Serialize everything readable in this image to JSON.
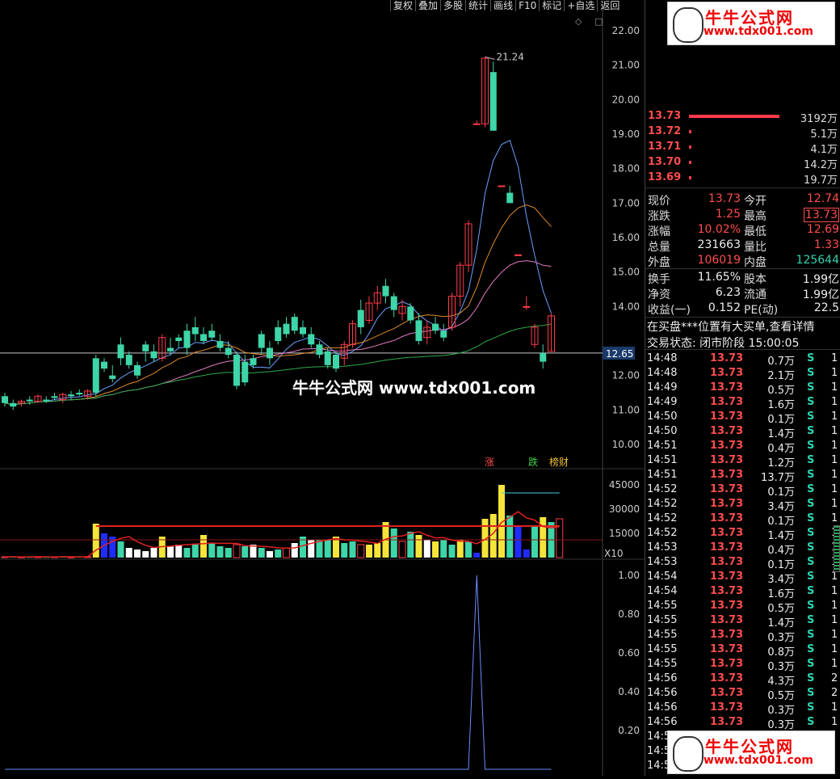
{
  "toolbar": [
    "复权",
    "叠加",
    "多股",
    "统计",
    "画线",
    "F10",
    "标记",
    "+自选",
    "返回"
  ],
  "main_chart": {
    "price_ticks": [
      "22.00",
      "21.00",
      "20.00",
      "19.00",
      "18.00",
      "17.00",
      "16.00",
      "15.00",
      "14.00",
      "12.00",
      "11.00",
      "10.00"
    ],
    "current_price_label": "12.65",
    "high_label": "21.24",
    "watermark": "牛牛公式网 www.tdx001.com",
    "tags": [
      "涨",
      "跌",
      "榜财"
    ],
    "ma_colors": {
      "ma5": "#6aa0ff",
      "ma10": "#e08a2a",
      "ma20": "#e07ac0",
      "ma60": "#2ea84a"
    }
  },
  "volume_chart": {
    "ticks": [
      "45000",
      "30000",
      "15000"
    ],
    "unit": "X10"
  },
  "indicator_chart": {
    "ticks": [
      "1.00",
      "0.80",
      "0.60",
      "0.40",
      "0.20"
    ]
  },
  "chart_data": [
    {
      "type": "candlestick",
      "ylim": [
        9.5,
        22.5
      ],
      "candles": [
        [
          11.4,
          11.5,
          11.1,
          11.2
        ],
        [
          11.2,
          11.3,
          11.0,
          11.1
        ],
        [
          11.2,
          11.3,
          11.1,
          11.25
        ],
        [
          11.3,
          11.4,
          11.15,
          11.25
        ],
        [
          11.25,
          11.45,
          11.2,
          11.4
        ],
        [
          11.3,
          11.4,
          11.2,
          11.25
        ],
        [
          11.4,
          11.5,
          11.3,
          11.35
        ],
        [
          11.3,
          11.5,
          11.2,
          11.45
        ],
        [
          11.45,
          11.55,
          11.3,
          11.4
        ],
        [
          11.5,
          11.6,
          11.4,
          11.45
        ],
        [
          11.4,
          11.6,
          11.3,
          11.55
        ],
        [
          12.5,
          12.6,
          11.4,
          11.5
        ],
        [
          12.4,
          12.5,
          12.1,
          12.2
        ],
        [
          12.0,
          12.3,
          11.8,
          11.9
        ],
        [
          12.9,
          13.1,
          12.3,
          12.5
        ],
        [
          12.6,
          12.7,
          12.2,
          12.3
        ],
        [
          12.3,
          12.4,
          11.9,
          12.0
        ],
        [
          12.9,
          13.0,
          12.4,
          12.7
        ],
        [
          12.7,
          12.9,
          12.4,
          12.5
        ],
        [
          12.5,
          13.2,
          12.4,
          13.1
        ],
        [
          12.8,
          13.1,
          12.6,
          12.7
        ],
        [
          13.1,
          13.2,
          12.8,
          13.0
        ],
        [
          13.3,
          13.5,
          12.6,
          12.8
        ],
        [
          13.4,
          13.7,
          13.0,
          13.2
        ],
        [
          13.2,
          13.4,
          12.9,
          13.0
        ],
        [
          13.3,
          13.5,
          13.0,
          13.1
        ],
        [
          13.0,
          13.2,
          12.7,
          12.8
        ],
        [
          12.8,
          13.0,
          12.5,
          12.6
        ],
        [
          12.6,
          12.7,
          11.6,
          11.7
        ],
        [
          12.4,
          12.6,
          11.7,
          11.8
        ],
        [
          12.5,
          12.6,
          12.2,
          12.3
        ],
        [
          13.2,
          13.3,
          12.6,
          12.8
        ],
        [
          12.8,
          13.0,
          12.3,
          12.5
        ],
        [
          13.4,
          13.6,
          12.9,
          13.0
        ],
        [
          13.5,
          13.7,
          13.1,
          13.2
        ],
        [
          13.7,
          13.8,
          13.2,
          13.3
        ],
        [
          13.4,
          13.6,
          13.1,
          13.2
        ],
        [
          13.2,
          13.4,
          12.8,
          12.9
        ],
        [
          12.9,
          13.0,
          12.5,
          12.6
        ],
        [
          12.7,
          12.8,
          12.2,
          12.3
        ],
        [
          12.6,
          12.7,
          12.1,
          12.2
        ],
        [
          12.5,
          13.0,
          12.3,
          12.9
        ],
        [
          12.9,
          13.6,
          12.8,
          13.5
        ],
        [
          13.9,
          14.2,
          13.2,
          13.4
        ],
        [
          13.6,
          14.3,
          13.5,
          14.1
        ],
        [
          14.1,
          14.6,
          13.9,
          14.4
        ],
        [
          14.6,
          14.8,
          14.1,
          14.3
        ],
        [
          14.3,
          14.4,
          13.7,
          13.9
        ],
        [
          13.8,
          14.2,
          13.6,
          14.0
        ],
        [
          14.0,
          14.1,
          13.5,
          13.6
        ],
        [
          13.6,
          13.8,
          12.9,
          13.0
        ],
        [
          13.1,
          13.6,
          12.9,
          13.4
        ],
        [
          13.5,
          13.7,
          13.2,
          13.3
        ],
        [
          13.3,
          13.5,
          13.0,
          13.1
        ],
        [
          13.4,
          14.4,
          13.3,
          14.3
        ],
        [
          14.3,
          15.3,
          14.0,
          15.2
        ],
        [
          15.2,
          16.5,
          15.0,
          16.4
        ],
        [
          19.3,
          19.4,
          19.3,
          19.3
        ],
        [
          19.3,
          21.24,
          19.2,
          21.2
        ],
        [
          20.8,
          21.1,
          19.1,
          19.1
        ],
        [
          17.5,
          17.5,
          17.5,
          17.5
        ],
        [
          17.3,
          17.5,
          17.0,
          17.0
        ],
        [
          15.5,
          15.5,
          15.5,
          15.5
        ],
        [
          14.0,
          14.3,
          13.9,
          14.0
        ],
        [
          12.9,
          13.5,
          12.8,
          13.4
        ],
        [
          12.65,
          12.9,
          12.2,
          12.4
        ],
        [
          12.7,
          13.8,
          12.7,
          13.73
        ]
      ]
    },
    {
      "type": "bar",
      "ylim": [
        0,
        50000
      ],
      "values": [
        500,
        500,
        400,
        400,
        600,
        400,
        500,
        500,
        400,
        500,
        600,
        21000,
        15000,
        13000,
        10000,
        6000,
        5000,
        4000,
        6000,
        13000,
        7000,
        8000,
        6000,
        8000,
        14000,
        9000,
        7000,
        6000,
        8000,
        7000,
        8000,
        6000,
        4000,
        5000,
        6000,
        9000,
        13000,
        11000,
        11000,
        11000,
        13000,
        9000,
        10000,
        8000,
        8000,
        9000,
        22000,
        18000,
        10000,
        16000,
        14000,
        11000,
        10000,
        11000,
        8000,
        11000,
        10000,
        3000,
        24000,
        27000,
        45000,
        26000,
        20000,
        5000,
        20000,
        25000,
        22000,
        24000
      ],
      "colors": [
        "r",
        "g",
        "r",
        "g",
        "r",
        "g",
        "r",
        "g",
        "r",
        "g",
        "r",
        "y",
        "b",
        "b",
        "g",
        "w",
        "w",
        "w",
        "w",
        "y",
        "w",
        "w",
        "g",
        "g",
        "y",
        "g",
        "g",
        "g",
        "r",
        "g",
        "w",
        "g",
        "w",
        "g",
        "r",
        "w",
        "g",
        "w",
        "g",
        "g",
        "y",
        "g",
        "g",
        "r",
        "y",
        "y",
        "y",
        "g",
        "r",
        "g",
        "y",
        "w",
        "y",
        "g",
        "g",
        "y",
        "g",
        "b",
        "y",
        "y",
        "y",
        "g",
        "b",
        "b",
        "g",
        "y",
        "g",
        "r"
      ],
      "line1_level": 19500,
      "line2_level": 40000
    },
    {
      "type": "line",
      "ylim": [
        0,
        1.0
      ],
      "peak_index": 57,
      "peak_value": 1.0
    }
  ],
  "right_panel": {
    "order_book": [
      {
        "price": "13.73",
        "vol": "3192万",
        "bar": 100
      },
      {
        "price": "13.72",
        "vol": "5.1万",
        "bar": 2
      },
      {
        "price": "13.71",
        "vol": "4.1万",
        "bar": 2
      },
      {
        "price": "13.70",
        "vol": "14.2万",
        "bar": 2
      },
      {
        "price": "13.69",
        "vol": "19.7万",
        "bar": 2
      }
    ],
    "quote": [
      {
        "l": "现价",
        "v": "13.73",
        "l2": "今开",
        "v2": "12.74"
      },
      {
        "l": "涨跌",
        "v": "1.25",
        "l2": "最高",
        "v2": "13.73"
      },
      {
        "l": "涨幅",
        "v": "10.02%",
        "l2": "最低",
        "v2": "12.69"
      },
      {
        "l": "总量",
        "v": "231663",
        "l2": "量比",
        "v2": "1.33"
      },
      {
        "l": "外盘",
        "v": "106019",
        "l2": "内盘",
        "v2": "125644"
      }
    ],
    "quote2": [
      {
        "l": "换手",
        "v": "11.65%",
        "l2": "股本",
        "v2": "1.99亿"
      },
      {
        "l": "净资",
        "v": "6.23",
        "l2": "流通",
        "v2": "1.99亿"
      },
      {
        "l": "收益(一)",
        "v": "0.152",
        "l2": "PE(动)",
        "v2": "22.5"
      }
    ],
    "notice": "在买盘***位置有大买单,查看详情",
    "status": "交易状态: 闭市阶段 15:00:05",
    "ticks": [
      {
        "t": "14:48",
        "p": "13.73",
        "v": "0.7万",
        "s": "S",
        "n": "1"
      },
      {
        "t": "14:48",
        "p": "13.73",
        "v": "2.1万",
        "s": "S",
        "n": "1"
      },
      {
        "t": "14:49",
        "p": "13.73",
        "v": "0.5万",
        "s": "S",
        "n": "1"
      },
      {
        "t": "14:49",
        "p": "13.73",
        "v": "1.6万",
        "s": "S",
        "n": "1"
      },
      {
        "t": "14:50",
        "p": "13.73",
        "v": "0.1万",
        "s": "S",
        "n": "1"
      },
      {
        "t": "14:50",
        "p": "13.73",
        "v": "1.4万",
        "s": "S",
        "n": "1"
      },
      {
        "t": "14:51",
        "p": "13.73",
        "v": "0.4万",
        "s": "S",
        "n": "1"
      },
      {
        "t": "14:51",
        "p": "13.73",
        "v": "1.2万",
        "s": "S",
        "n": "1"
      },
      {
        "t": "14:51",
        "p": "13.73",
        "v": "13.7万",
        "s": "S",
        "n": "1"
      },
      {
        "t": "14:52",
        "p": "13.73",
        "v": "0.1万",
        "s": "S",
        "n": "1"
      },
      {
        "t": "14:52",
        "p": "13.73",
        "v": "3.4万",
        "s": "S",
        "n": "1"
      },
      {
        "t": "14:52",
        "p": "13.73",
        "v": "0.1万",
        "s": "S",
        "n": "1"
      },
      {
        "t": "14:52",
        "p": "13.73",
        "v": "1.4万",
        "s": "S",
        "n": "1"
      },
      {
        "t": "14:53",
        "p": "13.73",
        "v": "0.4万",
        "s": "S",
        "n": "1"
      },
      {
        "t": "14:53",
        "p": "13.73",
        "v": "0.1万",
        "s": "S",
        "n": "1"
      },
      {
        "t": "14:54",
        "p": "13.73",
        "v": "3.4万",
        "s": "S",
        "n": "1"
      },
      {
        "t": "14:54",
        "p": "13.73",
        "v": "1.6万",
        "s": "S",
        "n": "1"
      },
      {
        "t": "14:55",
        "p": "13.73",
        "v": "0.5万",
        "s": "S",
        "n": "1"
      },
      {
        "t": "14:55",
        "p": "13.73",
        "v": "1.4万",
        "s": "S",
        "n": "1"
      },
      {
        "t": "14:55",
        "p": "13.73",
        "v": "0.3万",
        "s": "S",
        "n": "1"
      },
      {
        "t": "14:55",
        "p": "13.73",
        "v": "0.8万",
        "s": "S",
        "n": "1"
      },
      {
        "t": "14:55",
        "p": "13.73",
        "v": "0.3万",
        "s": "S",
        "n": "1"
      },
      {
        "t": "14:56",
        "p": "13.73",
        "v": "4.3万",
        "s": "S",
        "n": "2"
      },
      {
        "t": "14:56",
        "p": "13.73",
        "v": "0.5万",
        "s": "S",
        "n": "2"
      },
      {
        "t": "14:56",
        "p": "13.73",
        "v": "0.3万",
        "s": "S",
        "n": "1"
      },
      {
        "t": "14:56",
        "p": "13.73",
        "v": "0.3万",
        "s": "S",
        "n": "1"
      },
      {
        "t": "14:5",
        "p": "",
        "v": "",
        "s": "",
        "n": ""
      },
      {
        "t": "14:5",
        "p": "",
        "v": "",
        "s": "",
        "n": ""
      },
      {
        "t": "14:5",
        "p": "",
        "v": "",
        "s": "",
        "n": ""
      }
    ]
  },
  "banner": {
    "title": "牛牛公式网",
    "url": "www.tdx001.com"
  }
}
